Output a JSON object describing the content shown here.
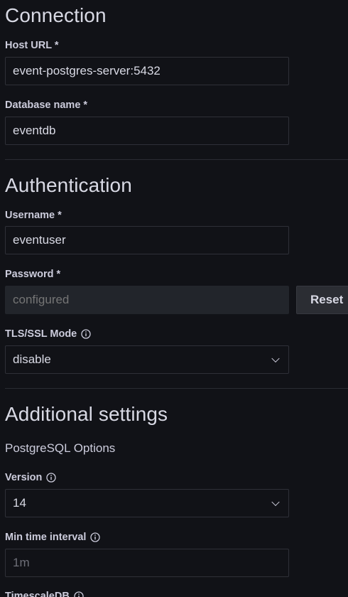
{
  "connection": {
    "title": "Connection",
    "host_label": "Host URL *",
    "host_value": "event-postgres-server:5432",
    "db_label": "Database name *",
    "db_value": "eventdb"
  },
  "authentication": {
    "title": "Authentication",
    "username_label": "Username *",
    "username_value": "eventuser",
    "password_label": "Password *",
    "password_placeholder": "configured",
    "reset_label": "Reset",
    "tls_label": "TLS/SSL Mode",
    "tls_value": "disable"
  },
  "additional": {
    "title": "Additional settings",
    "subheading": "PostgreSQL Options",
    "version_label": "Version",
    "version_value": "14",
    "min_interval_label": "Min time interval",
    "min_interval_placeholder": "1m",
    "timescale_label": "TimescaleDB"
  },
  "icons": {
    "info": "info-circle-icon",
    "chevron": "chevron-down-icon"
  }
}
